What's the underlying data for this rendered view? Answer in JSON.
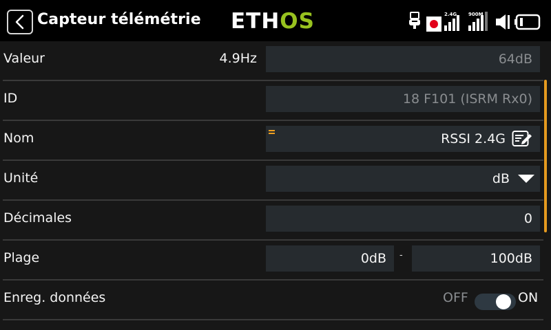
{
  "header": {
    "title": "Capteur télémétrie",
    "logo_main": "ETH",
    "logo_accent": "OS",
    "back_icon": "chevron-left-icon",
    "status": {
      "usb_icon": "usb-icon",
      "record_icon": "record-icon",
      "signal_1_label": "2.4G",
      "signal_2_label": "900M",
      "speaker_icon": "speaker-icon",
      "battery_icon": "battery-icon"
    }
  },
  "rows": {
    "valeur": {
      "label": "Valeur",
      "rate": "4.9Hz",
      "value": "64dB"
    },
    "id": {
      "label": "ID",
      "value": "18 F101 (ISRM Rx0)"
    },
    "nom": {
      "label": "Nom",
      "value": "RSSI 2.4G",
      "icon": "edit-icon"
    },
    "unite": {
      "label": "Unité",
      "value": "dB",
      "icon": "dropdown-triangle-icon"
    },
    "decimales": {
      "label": "Décimales",
      "value": "0"
    },
    "plage": {
      "label": "Plage",
      "min": "0dB",
      "separator": "-",
      "max": "100dB"
    },
    "enreg": {
      "label": "Enreg. données",
      "off_label": "OFF",
      "on_label": "ON",
      "enabled": true
    }
  },
  "colors": {
    "accent_orange": "#e59a1f",
    "logo_green": "#98c21f",
    "field_bg": "#262b2f",
    "background": "#171717",
    "record_red": "#e2001a"
  }
}
